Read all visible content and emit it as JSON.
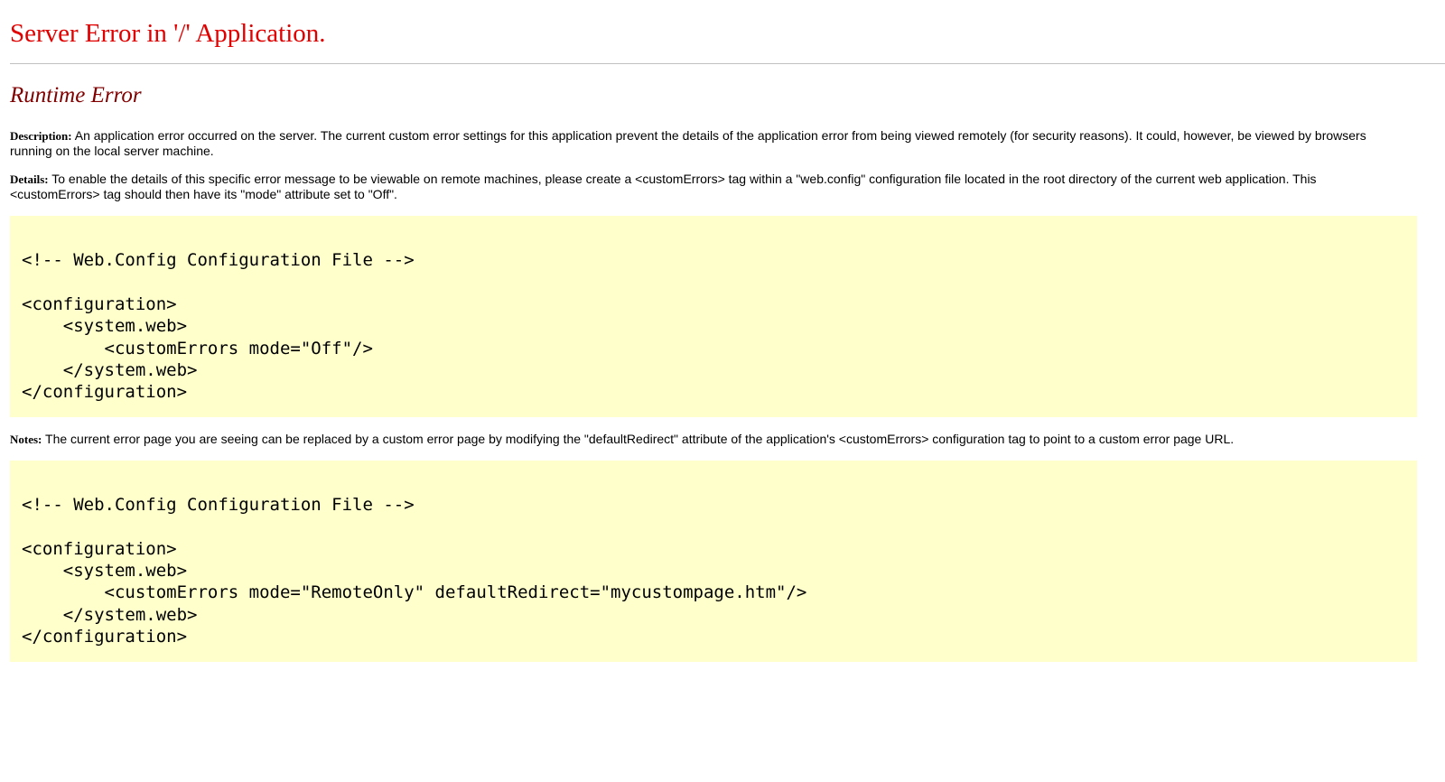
{
  "title": "Server Error in '/' Application.",
  "subtitle": "Runtime Error",
  "description": {
    "label": "Description:",
    "text": " An application error occurred on the server. The current custom error settings for this application prevent the details of the application error from being viewed remotely (for security reasons). It could, however, be viewed by browsers running on the local server machine."
  },
  "details": {
    "label": "Details:",
    "text": " To enable the details of this specific error message to be viewable on remote machines, please create a <customErrors> tag within a \"web.config\" configuration file located in the root directory of the current web application. This <customErrors> tag should then have its \"mode\" attribute set to \"Off\"."
  },
  "code_block_1": "<!-- Web.Config Configuration File -->\n\n<configuration>\n    <system.web>\n        <customErrors mode=\"Off\"/>\n    </system.web>\n</configuration>",
  "notes": {
    "label": "Notes:",
    "text": " The current error page you are seeing can be replaced by a custom error page by modifying the \"defaultRedirect\" attribute of the application's <customErrors> configuration tag to point to a custom error page URL."
  },
  "code_block_2": "<!-- Web.Config Configuration File -->\n\n<configuration>\n    <system.web>\n        <customErrors mode=\"RemoteOnly\" defaultRedirect=\"mycustompage.htm\"/>\n    </system.web>\n</configuration>",
  "colors": {
    "title": "#e10000",
    "subtitle": "#800000",
    "code_background": "#ffffcc"
  }
}
